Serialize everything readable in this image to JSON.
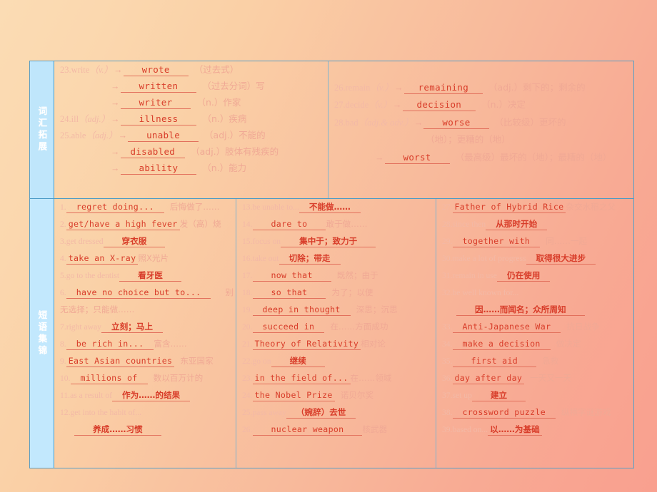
{
  "sections": {
    "vocab_label": "词汇拓展",
    "phrase_label": "短语集锦"
  },
  "vocab": {
    "left": [
      {
        "n": "23.",
        "word": "write",
        "pos": "（v.）",
        "arrow": "→",
        "answer": "wrote",
        "gloss": "（过去式）"
      },
      {
        "n": "",
        "word": "",
        "pos": "",
        "arrow": "→",
        "answer": "written",
        "gloss": "（过去分词）写"
      },
      {
        "n": "",
        "word": "",
        "pos": "",
        "arrow": "→",
        "answer": "writer",
        "gloss": "（n.）作家"
      },
      {
        "n": "24.",
        "word": "ill",
        "pos": "（adj.）",
        "arrow": "→",
        "answer": "illness",
        "gloss": "（n.）疾病"
      },
      {
        "n": "25.",
        "word": "able",
        "pos": "（adj.）",
        "arrow": "→",
        "answer": "unable",
        "gloss": "（adj.）不能的"
      },
      {
        "n": "",
        "word": "",
        "pos": "",
        "arrow": "→",
        "answer": "disabled",
        "gloss": "（adj.）肢体有残疾的"
      },
      {
        "n": "",
        "word": "",
        "pos": "",
        "arrow": "→",
        "answer": "ability",
        "gloss": "（n.）能力"
      }
    ],
    "right": [
      {
        "n": "26.",
        "word": "remain",
        "pos": "（v.）",
        "arrow": "→",
        "answer": "remaining",
        "gloss": "（adj.）剩下的；剩余的"
      },
      {
        "n": "27.",
        "word": "decide",
        "pos": "（v.）",
        "arrow": "→",
        "answer": "decision",
        "gloss": "（n.）决定"
      },
      {
        "n": "28.",
        "word": "bad",
        "pos": "（adj.& adv.）",
        "arrow": "→",
        "answer": "worse",
        "gloss": "（比较级）更坏的"
      },
      {
        "n": "",
        "word": "",
        "pos": "",
        "arrow": "",
        "answer": "",
        "gloss": "（地）；更糟的（地）"
      },
      {
        "n": "",
        "word": "",
        "pos": "",
        "arrow": "→",
        "answer": "worst",
        "gloss": "（最高级）最坏的（地）；最糟的（地）"
      }
    ]
  },
  "phrases": {
    "col1": [
      {
        "n": "1.",
        "en": "regret doing...",
        "cn": "后悔做了……"
      },
      {
        "n": "2.",
        "en": "get/have a high fever",
        "cn": "发（高）烧"
      },
      {
        "n": "3.",
        "prompt": "get dressed",
        "cn": "穿衣服"
      },
      {
        "n": "4.",
        "en": "take an X-ray",
        "cn": "照X光片"
      },
      {
        "n": "5.",
        "prompt": "go to the dentist",
        "cn": "看牙医"
      },
      {
        "n": "6.",
        "en": "have no choice but to...",
        "cn": "别"
      },
      {
        "n": "",
        "cont": "无选择；只能做……"
      },
      {
        "n": "7.",
        "prompt": "right away",
        "cn": "立刻；马上"
      },
      {
        "n": "8.",
        "en": "be rich in...",
        "cn": "富含……"
      },
      {
        "n": "9.",
        "en": "East Asian countries",
        "cn": "东亚国家"
      },
      {
        "n": "10.",
        "en": "millions of",
        "cn": "数以百万计的"
      },
      {
        "n": "11.",
        "prompt": "as a result of",
        "cn": "作为……的结果"
      },
      {
        "n": "12.",
        "prompt": "get into the habit of...",
        "cn": ""
      },
      {
        "n": "",
        "cn2": "养成……习惯"
      }
    ],
    "col2": [
      {
        "n": "13.",
        "prompt": "be unable to...",
        "cn": "不能做……"
      },
      {
        "n": "14.",
        "en": "dare to",
        "cn": "敢于做……"
      },
      {
        "n": "15.",
        "prompt": "focus on",
        "cn": "集中于；致力于"
      },
      {
        "n": "16.",
        "prompt": "take out",
        "cn": "切除；带走"
      },
      {
        "n": "17.",
        "en": "now that",
        "cn": "既然；由于"
      },
      {
        "n": "18.",
        "en": "so that",
        "cn": "为了；以便"
      },
      {
        "n": "19.",
        "en": "deep in thought",
        "cn": "深思；沉思"
      },
      {
        "n": "20.",
        "en": "succeed in",
        "cn": "在……方面成功"
      },
      {
        "n": "21.",
        "en": "Theory of Relativity",
        "cn": "相对论"
      },
      {
        "n": "22.",
        "prompt": "go on",
        "cn": "继续"
      },
      {
        "n": "23.",
        "en": "in the field of...",
        "cn": "在……领域"
      },
      {
        "n": "24.",
        "en": "the Nobel Prize",
        "cn": "诺贝尔奖"
      },
      {
        "n": "25.",
        "prompt": "pass away",
        "cn": "（婉辞）去世"
      },
      {
        "n": "26.",
        "en": "nuclear weapon",
        "cn": "核武器"
      }
    ],
    "col3": [
      {
        "n": "27.",
        "en": "Father of Hybrid Rice",
        "cn": "杂交水稻之父"
      },
      {
        "n": "28.",
        "prompt": "since then",
        "cn": "从那时开始"
      },
      {
        "n": "29.",
        "en": "together with",
        "cn": "同……一起"
      },
      {
        "n": "30.",
        "prompt": "make a lot of progress",
        "cn": "取得很大进步"
      },
      {
        "n": "31.",
        "prompt": "remain in use",
        "cn": "仍在使用"
      },
      {
        "n": "32.",
        "prompt": "be well known for...",
        "cn": ""
      },
      {
        "n": "",
        "cn2": "因……而闻名；众所周知"
      },
      {
        "n": "33.",
        "en": "Anti-Japanese War",
        "cn": "抗日战争"
      },
      {
        "n": "34.",
        "en": "make a decision",
        "cn": "做决定"
      },
      {
        "n": "35.",
        "en": "first aid",
        "cn": "急救"
      },
      {
        "n": "36.",
        "en": "day after day",
        "cn": "一天又一天"
      },
      {
        "n": "37.",
        "prompt": "set up",
        "cn": "建立"
      },
      {
        "n": "38.",
        "en": "crossword puzzle",
        "cn": "纵横字谜游戏"
      },
      {
        "n": "39.",
        "prompt": "based on...",
        "cn": "以……为基础"
      }
    ]
  },
  "colors": {
    "table_border": "#5b9fc4",
    "gutter_bg": "#bfe6fb",
    "answer_red": "#d83d2a",
    "prompt_faded": "#f3b9a6"
  }
}
